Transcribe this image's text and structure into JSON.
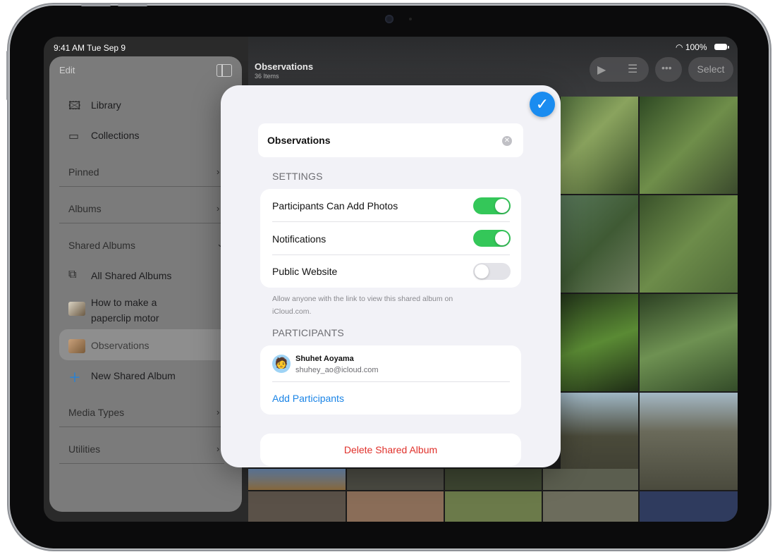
{
  "status_bar": {
    "time": "9:41 AM  Tue Sep 9",
    "battery": "100%"
  },
  "album": {
    "title": "Observations",
    "count": "36 Items"
  },
  "toolbar": {
    "select_label": "Select"
  },
  "sidebar": {
    "edit_label": "Edit",
    "items": [
      {
        "label": "Library",
        "icon": "photo-library-icon"
      },
      {
        "label": "Collections",
        "icon": "collections-icon"
      }
    ],
    "sections": [
      {
        "label": "Pinned"
      },
      {
        "label": "Albums"
      },
      {
        "label": "Shared Albums"
      },
      {
        "label": "Media Types"
      },
      {
        "label": "Utilities"
      }
    ],
    "shared_items": [
      {
        "label": "All Shared Albums"
      },
      {
        "label": "How to make a"
      },
      {
        "label": "paperclip motor"
      },
      {
        "label": "Observations"
      },
      {
        "label": "New Shared Album"
      }
    ]
  },
  "dialog": {
    "name_value": "Observations",
    "settings_header": "SETTINGS",
    "rows": [
      {
        "label": "Participants Can Add Photos",
        "on": true
      },
      {
        "label": "Notifications",
        "on": true
      },
      {
        "label": "Public Website",
        "on": false
      }
    ],
    "footnote": "Allow anyone with the link to view this shared album on iCloud.com.",
    "participants_header": "PARTICIPANTS",
    "participant": {
      "name": "Shuhet Aoyama",
      "email": "shuhey_ao@icloud.com"
    },
    "add_participants": "Add Participants",
    "delete_label": "Delete Shared Album"
  },
  "colors": {
    "accent": "#1a8cf0",
    "toggle_on": "#34c759",
    "destructive": "#e0312b"
  }
}
